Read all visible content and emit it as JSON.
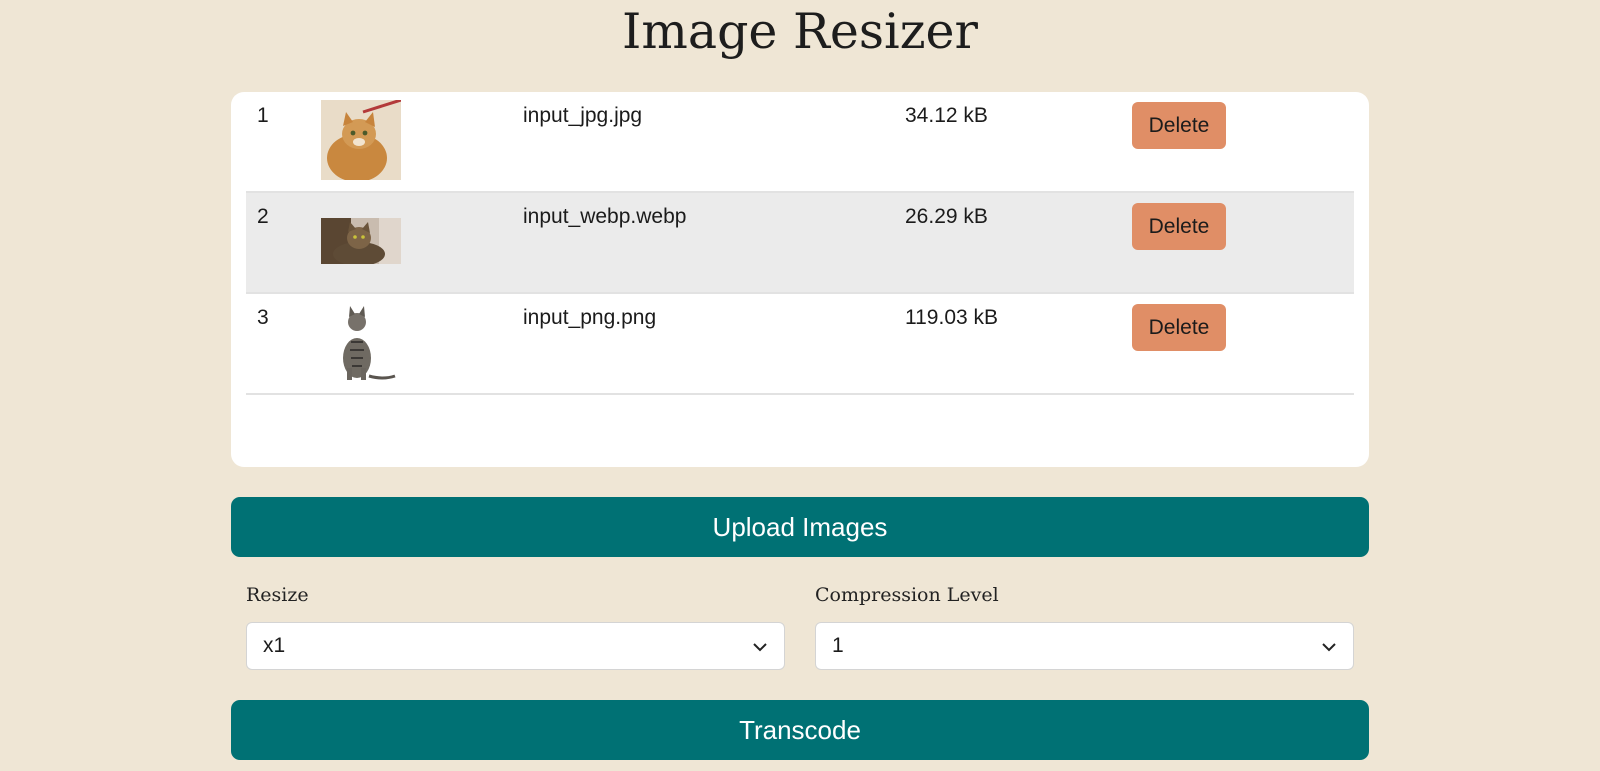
{
  "page": {
    "title": "Image Resizer"
  },
  "files": [
    {
      "index": "1",
      "name": "input_jpg.jpg",
      "size": "34.12 kB",
      "delete_label": "Delete"
    },
    {
      "index": "2",
      "name": "input_webp.webp",
      "size": "26.29 kB",
      "delete_label": "Delete"
    },
    {
      "index": "3",
      "name": "input_png.png",
      "size": "119.03 kB",
      "delete_label": "Delete"
    }
  ],
  "actions": {
    "upload_label": "Upload Images",
    "transcode_label": "Transcode"
  },
  "resize": {
    "label": "Resize",
    "value": "x1"
  },
  "compression": {
    "label": "Compression Level",
    "value": "1"
  },
  "colors": {
    "background": "#efe6d5",
    "primary": "#007174",
    "delete": "#e08e66"
  },
  "icons": {
    "select_arrow": "chevron-down-icon"
  }
}
